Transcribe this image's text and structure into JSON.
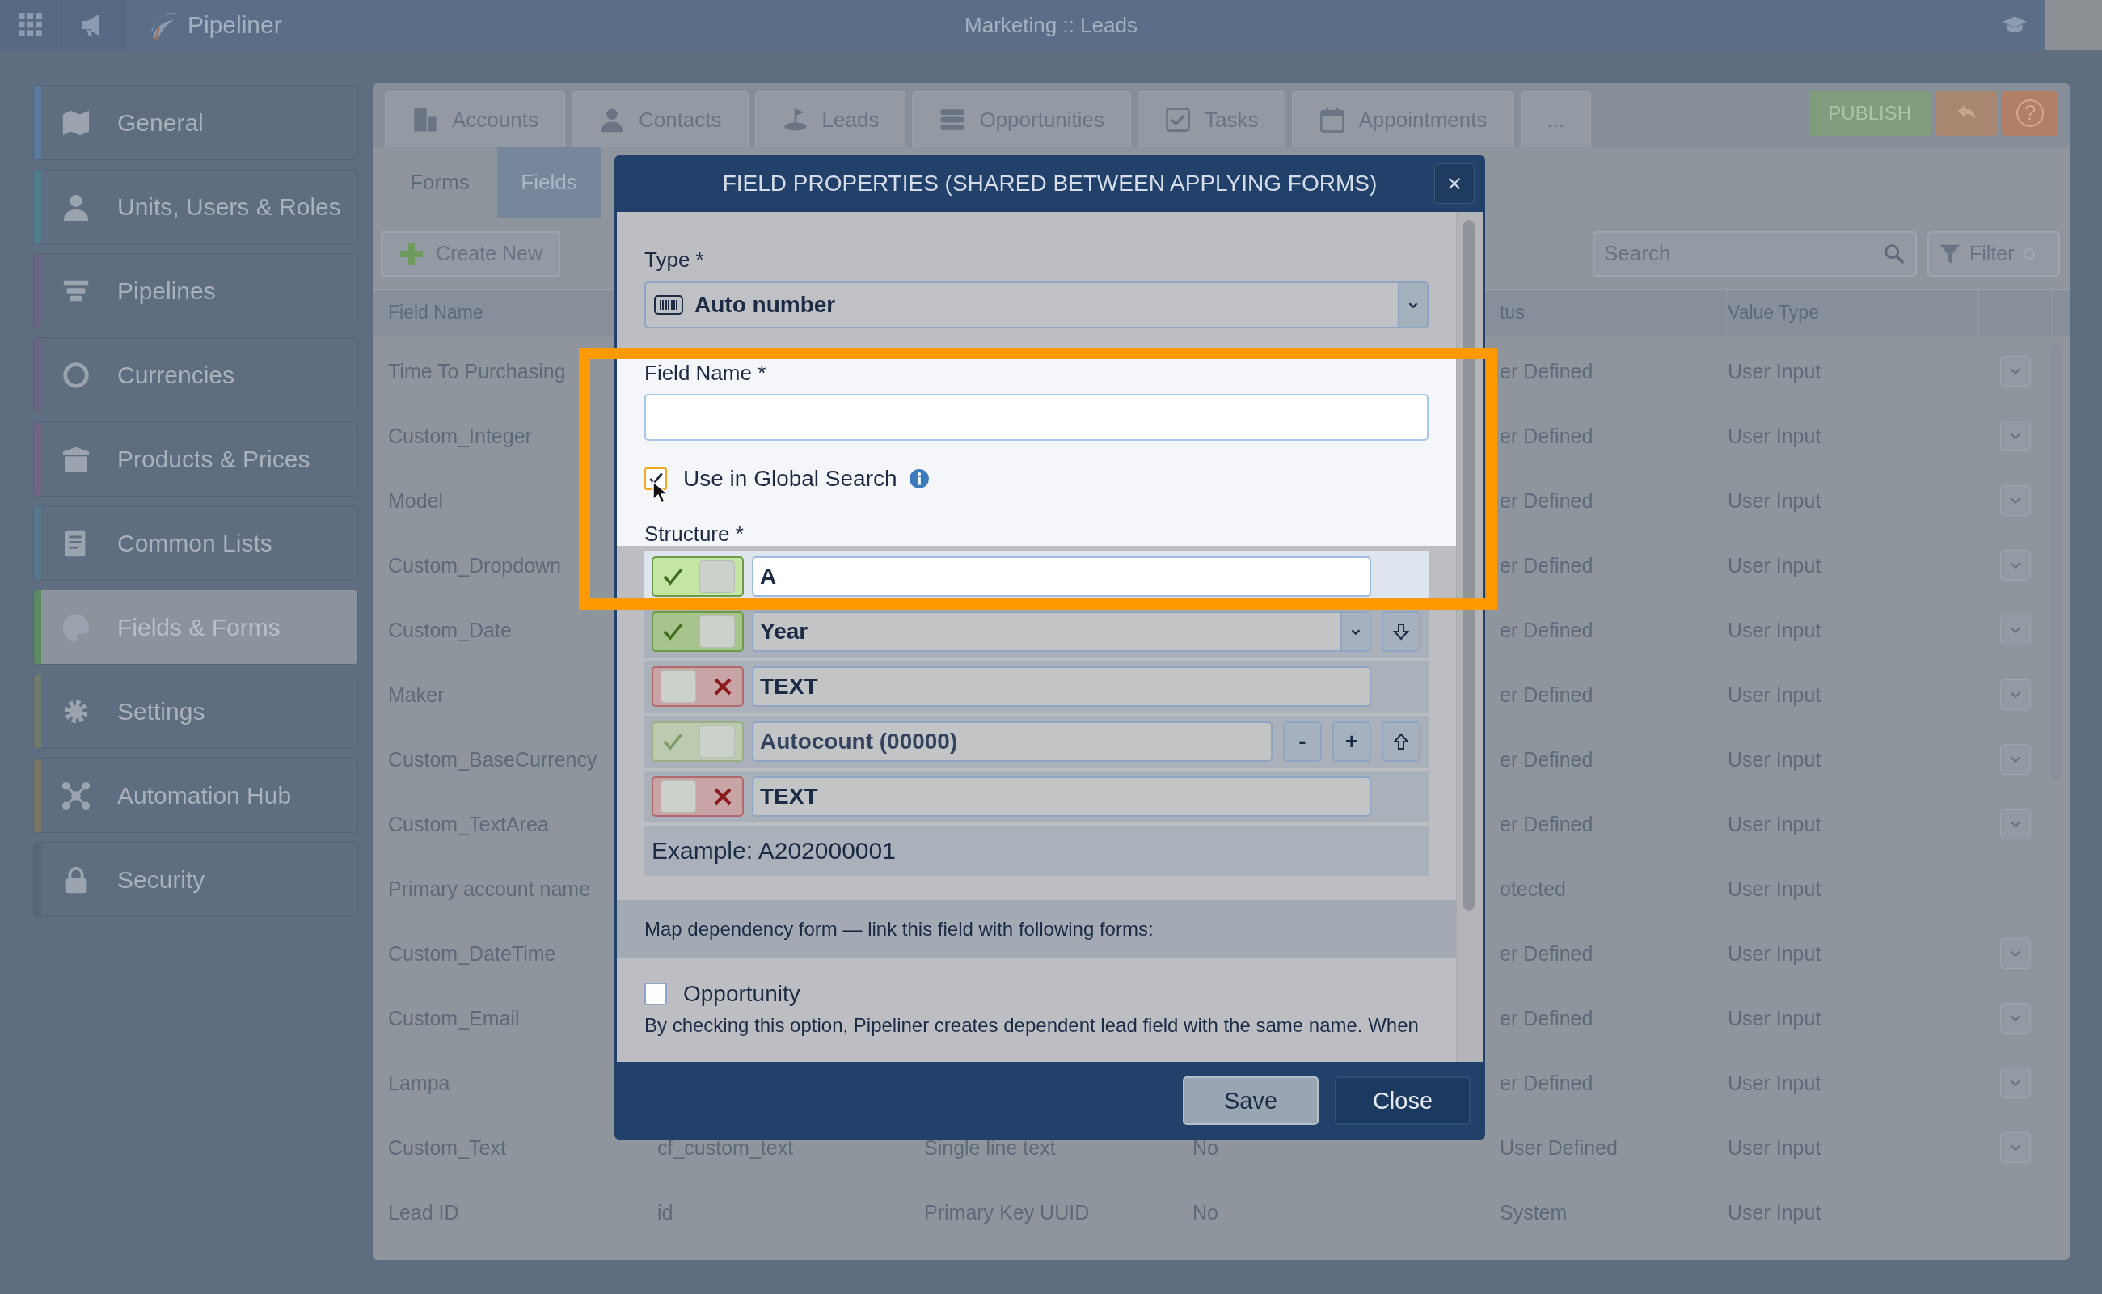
{
  "top_bar": {
    "app_name": "Pipeliner",
    "title": "Marketing :: Leads"
  },
  "sidebar": {
    "items": [
      {
        "label": "General",
        "color": "#5a7b9e",
        "selected": false
      },
      {
        "label": "Units, Users & Roles",
        "color": "#4f8089",
        "selected": false
      },
      {
        "label": "Pipelines",
        "color": "#6b6585",
        "selected": false
      },
      {
        "label": "Currencies",
        "color": "#6b6585",
        "selected": false
      },
      {
        "label": "Products & Prices",
        "color": "#6d6583",
        "selected": false
      },
      {
        "label": "Common Lists",
        "color": "#56788f",
        "selected": false
      },
      {
        "label": "Fields & Forms",
        "color": "#5b8a63",
        "selected": true
      },
      {
        "label": "Settings",
        "color": "#6f7a6c",
        "selected": false
      },
      {
        "label": "Automation Hub",
        "color": "#7a7466",
        "selected": false
      },
      {
        "label": "Security",
        "color": "#5a6578",
        "selected": false
      }
    ]
  },
  "tabs": [
    {
      "label": "Accounts"
    },
    {
      "label": "Contacts"
    },
    {
      "label": "Leads"
    },
    {
      "label": "Opportunities"
    },
    {
      "label": "Tasks"
    },
    {
      "label": "Appointments"
    },
    {
      "label": "..."
    }
  ],
  "actions": {
    "publish": "PUBLISH",
    "help": "?"
  },
  "subtabs": [
    {
      "label": "Forms",
      "selected": false
    },
    {
      "label": "Fields",
      "selected": true
    }
  ],
  "toolbar": {
    "create_button": "Create New",
    "search_placeholder": "Search",
    "filter_button": "Filter"
  },
  "table": {
    "columns": {
      "field_name": "Field Name",
      "column_5": "tus",
      "value_type": "Value Type"
    },
    "rows": [
      {
        "field_name": "Time To Purchasing",
        "column_5": "er Defined",
        "value_type": "User Input",
        "has_menu": true
      },
      {
        "field_name": "Custom_Integer",
        "column_5": "er Defined",
        "value_type": "User Input",
        "has_menu": true
      },
      {
        "field_name": "Model",
        "column_5": "er Defined",
        "value_type": "User Input",
        "has_menu": true
      },
      {
        "field_name": "Custom_Dropdown",
        "column_5": "er Defined",
        "value_type": "User Input",
        "has_menu": true
      },
      {
        "field_name": "Custom_Date",
        "column_5": "er Defined",
        "value_type": "User Input",
        "has_menu": true
      },
      {
        "field_name": "Maker",
        "column_5": "er Defined",
        "value_type": "User Input",
        "has_menu": true
      },
      {
        "field_name": "Custom_BaseCurrency",
        "column_5": "er Defined",
        "value_type": "User Input",
        "has_menu": true
      },
      {
        "field_name": "Custom_TextArea",
        "column_5": "er Defined",
        "value_type": "User Input",
        "has_menu": true
      },
      {
        "field_name": "Primary account name",
        "column_5": "otected",
        "value_type": "User Input",
        "has_menu": false
      },
      {
        "field_name": "Custom_DateTime",
        "column_5": "er Defined",
        "value_type": "User Input",
        "has_menu": true
      },
      {
        "field_name": "Custom_Email",
        "column_5": "er Defined",
        "value_type": "User Input",
        "has_menu": true
      },
      {
        "field_name": "Lampa",
        "column_5": "er Defined",
        "value_type": "User Input",
        "has_menu": true
      },
      {
        "field_name": "Custom_Text",
        "column_2": "cf_custom_text",
        "column_3": "Single line text",
        "column_4": "No",
        "column_5": "User Defined",
        "value_type": "User Input",
        "has_menu": true
      },
      {
        "field_name": "Lead ID",
        "column_2": "id",
        "column_3": "Primary Key UUID",
        "column_4": "No",
        "column_5": "System",
        "value_type": "User Input",
        "has_menu": false
      }
    ]
  },
  "modal": {
    "title": "FIELD PROPERTIES (SHARED BETWEEN APPLYING FORMS)",
    "type_label": "Type *",
    "type_value": "Auto number",
    "field_name_label": "Field Name *",
    "global_search": {
      "label": "Use in Global Search",
      "checked": true
    },
    "structure_label": "Structure *",
    "structure": [
      {
        "kind": "text",
        "enabled": true,
        "disabled": false,
        "value": "A",
        "move_up": false,
        "move_down": false
      },
      {
        "kind": "select",
        "enabled": true,
        "disabled": false,
        "value": "Year",
        "move_up": false,
        "move_down": true
      },
      {
        "kind": "text",
        "enabled": false,
        "disabled": false,
        "value": "TEXT",
        "move_up": false,
        "move_down": false
      },
      {
        "kind": "counter",
        "enabled": true,
        "disabled": true,
        "value": "Autocount (00000)",
        "decrement": "-",
        "increment": "+",
        "move_up": true,
        "move_down": false
      },
      {
        "kind": "text",
        "enabled": false,
        "disabled": false,
        "value": "TEXT",
        "move_up": false,
        "move_down": false
      }
    ],
    "example": "Example: A202000001",
    "map_heading": "Map dependency form — link this field with following forms:",
    "forms": [
      {
        "label": "Opportunity",
        "checked": false
      }
    ],
    "note": "By checking this option, Pipeliner creates dependent lead field with the same name. When",
    "buttons": [
      {
        "label": "Save",
        "kind": "secondary"
      },
      {
        "label": "Close",
        "kind": "primary"
      }
    ]
  }
}
